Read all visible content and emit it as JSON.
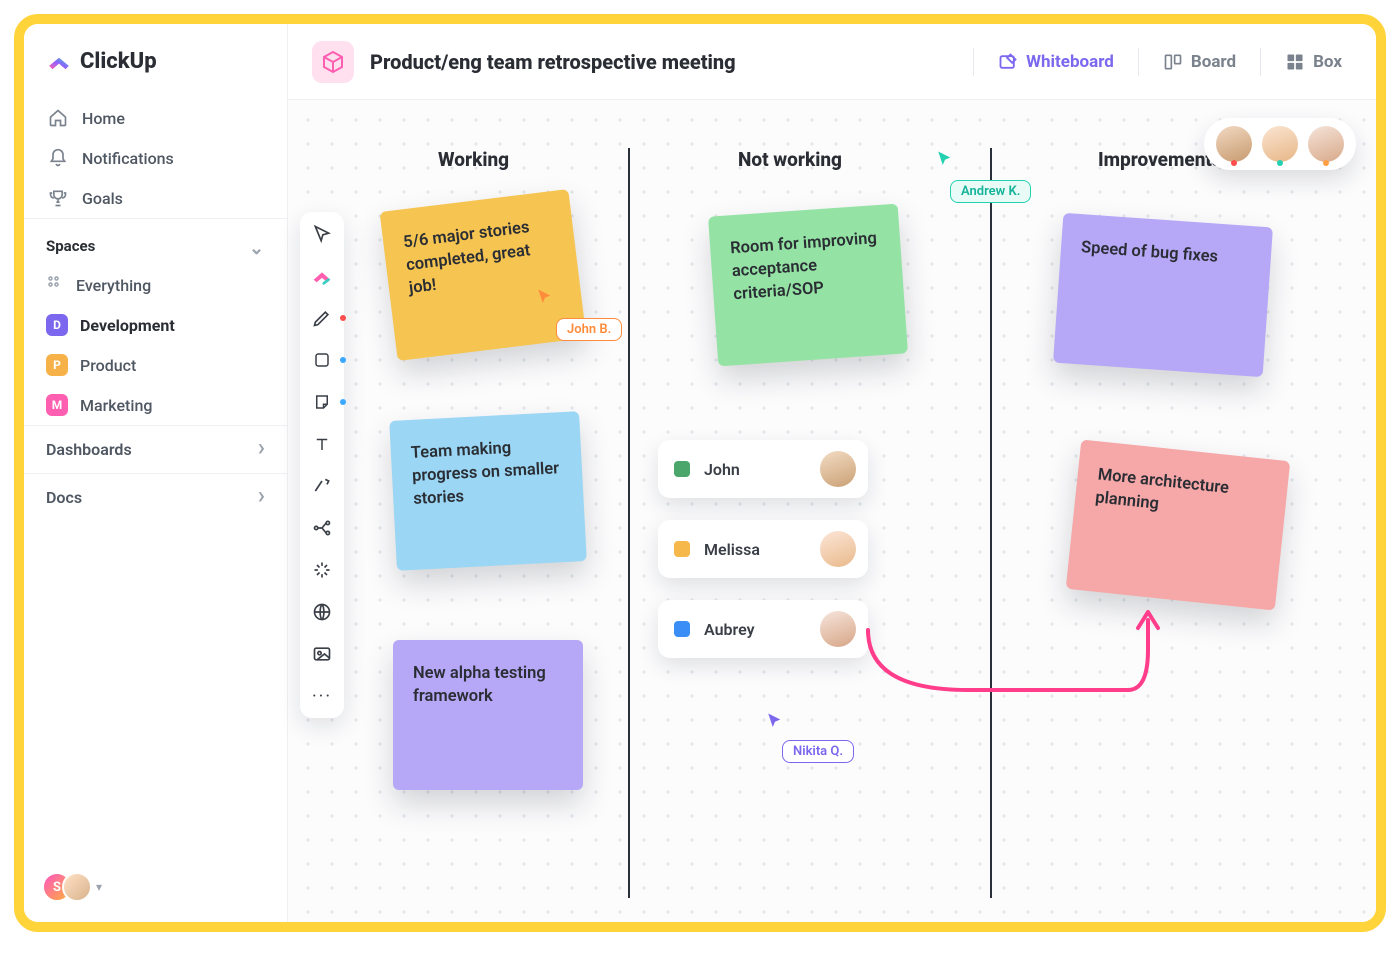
{
  "brand": {
    "name": "ClickUp"
  },
  "nav": {
    "home": "Home",
    "notifications": "Notifications",
    "goals": "Goals"
  },
  "spaces": {
    "header": "Spaces",
    "everything": "Everything",
    "items": [
      {
        "letter": "D",
        "label": "Development",
        "color": "#7b68ee",
        "bold": true
      },
      {
        "letter": "P",
        "label": "Product",
        "color": "#f6b249",
        "bold": false
      },
      {
        "letter": "M",
        "label": "Marketing",
        "color": "#ff5fb0",
        "bold": false
      }
    ]
  },
  "sections": {
    "dashboards": "Dashboards",
    "docs": "Docs"
  },
  "user_badge_letter": "S",
  "header": {
    "title": "Product/eng team retrospective meeting",
    "tabs": {
      "whiteboard": "Whiteboard",
      "board": "Board",
      "box": "Box"
    }
  },
  "columns": {
    "working": "Working",
    "not_working": "Not working",
    "improvements": "Improvements"
  },
  "notes": {
    "yellow": "5/6 major stories completed, great job!",
    "blue": "Team making progress on smaller stories",
    "purple": "New alpha testing framework",
    "green": "Room for improving acceptance criteria/SOP",
    "lav": "Speed of bug fixes",
    "pink": "More architecture planning"
  },
  "cursors": {
    "john": "John B.",
    "andrew": "Andrew K.",
    "nikita": "Nikita Q."
  },
  "people": [
    {
      "name": "John",
      "color": "#4aa66a",
      "avatar": "av-john"
    },
    {
      "name": "Melissa",
      "color": "#f6b84b",
      "avatar": "av-mel"
    },
    {
      "name": "Aubrey",
      "color": "#3a8ef5",
      "avatar": "av-aub"
    }
  ],
  "toolbar_icons": [
    "cursor",
    "clickup",
    "pen",
    "square",
    "sticky",
    "text",
    "connector",
    "tree",
    "sparkle",
    "globe",
    "image",
    "more"
  ]
}
